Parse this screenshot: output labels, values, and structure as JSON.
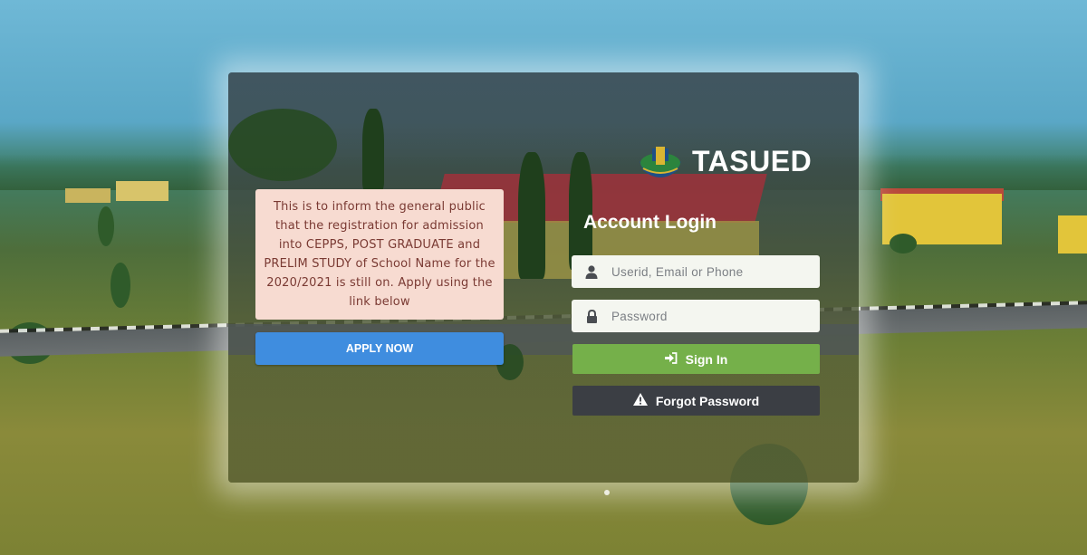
{
  "brand": {
    "name": "TASUED",
    "logo_icon": "university-crest-icon"
  },
  "notice": {
    "text": "This is to inform the general public that the registration for admission into CEPPS, POST GRADUATE and PRELIM STUDY of School Name for the 2020/2021 is still on. Apply using the link below",
    "apply_label": "APPLY NOW"
  },
  "login": {
    "title": "Account Login",
    "userid_placeholder": "Userid, Email or Phone",
    "userid_icon": "user-icon",
    "password_placeholder": "Password",
    "password_icon": "lock-icon",
    "signin_label": "Sign In",
    "signin_icon": "sign-in-icon",
    "forgot_label": "Forgot Password",
    "forgot_icon": "warning-icon"
  },
  "colors": {
    "notice_bg": "#f7dbd1",
    "apply_bg": "#3f8ddf",
    "signin_bg": "#75b04a",
    "forgot_bg": "#3b3e44"
  }
}
